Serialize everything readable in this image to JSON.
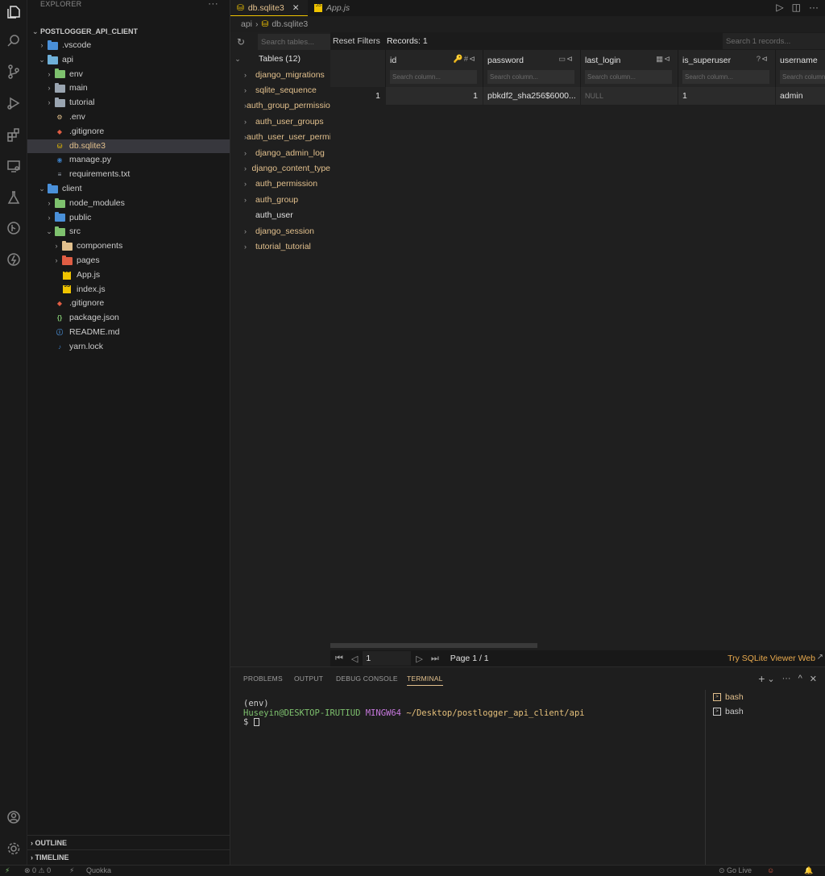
{
  "colors": {
    "accent": "#f0c400",
    "modified_file": "#e2c08d",
    "link": "#e8a94d",
    "terminal_user": "#7ec16e",
    "terminal_system": "#c678dd",
    "terminal_path": "#e5c07b"
  },
  "explorer": {
    "title": "EXPLORER",
    "project": "POSTLOGGER_API_CLIENT",
    "more": "···",
    "tree": [
      {
        "label": ".vscode",
        "type": "folder",
        "color": "#4a90d9",
        "depth": 0,
        "expanded": false
      },
      {
        "label": "api",
        "type": "folder",
        "color": "#6fb0d8",
        "depth": 0,
        "expanded": true
      },
      {
        "label": "env",
        "type": "folder",
        "color": "#7ec16e",
        "depth": 1,
        "expanded": false
      },
      {
        "label": "main",
        "type": "folder",
        "color": "#9aa5b1",
        "depth": 1,
        "expanded": false
      },
      {
        "label": "tutorial",
        "type": "folder",
        "color": "#9aa5b1",
        "depth": 1,
        "expanded": false
      },
      {
        "label": ".env",
        "type": "env",
        "color": "#e2c08d",
        "depth": 1
      },
      {
        "label": ".gitignore",
        "type": "git",
        "color": "#e05d44",
        "depth": 1
      },
      {
        "label": "db.sqlite3",
        "type": "db",
        "color": "#f0c400",
        "depth": 1,
        "selected": true,
        "modified": true
      },
      {
        "label": "manage.py",
        "type": "py",
        "color": "#3b7bbf",
        "depth": 1
      },
      {
        "label": "requirements.txt",
        "type": "txt",
        "color": "#9aa5b1",
        "depth": 1
      },
      {
        "label": "client",
        "type": "folder",
        "color": "#4a90d9",
        "depth": 0,
        "expanded": true
      },
      {
        "label": "node_modules",
        "type": "folder",
        "color": "#7ec16e",
        "depth": 1,
        "expanded": false
      },
      {
        "label": "public",
        "type": "folder",
        "color": "#4a90d9",
        "depth": 1,
        "expanded": false
      },
      {
        "label": "src",
        "type": "folder",
        "color": "#7ec16e",
        "depth": 1,
        "expanded": true
      },
      {
        "label": "components",
        "type": "folder",
        "color": "#e2c08d",
        "depth": 2,
        "expanded": false
      },
      {
        "label": "pages",
        "type": "folder",
        "color": "#e05d44",
        "depth": 2,
        "expanded": false
      },
      {
        "label": "App.js",
        "type": "js",
        "color": "#f0c400",
        "depth": 2
      },
      {
        "label": "index.js",
        "type": "js",
        "color": "#f0c400",
        "depth": 2
      },
      {
        "label": ".gitignore",
        "type": "git",
        "color": "#e05d44",
        "depth": 1
      },
      {
        "label": "package.json",
        "type": "json",
        "color": "#7ec16e",
        "depth": 1
      },
      {
        "label": "README.md",
        "type": "info",
        "color": "#4a90d9",
        "depth": 1
      },
      {
        "label": "yarn.lock",
        "type": "yarn",
        "color": "#3b7bbf",
        "depth": 1
      }
    ],
    "outline": "OUTLINE",
    "timeline": "TIMELINE"
  },
  "tabs": [
    {
      "label": "db.sqlite3",
      "active": true,
      "close": "✕"
    },
    {
      "label": "App.js",
      "active": false
    }
  ],
  "breadcrumb": {
    "folder": "api",
    "sep": "›",
    "file": "db.sqlite3"
  },
  "sqlite": {
    "table_search_placeholder": "Search tables...",
    "tables_header": "Tables (12)",
    "tables": [
      {
        "name": "django_migrations",
        "active": false
      },
      {
        "name": "sqlite_sequence",
        "active": false
      },
      {
        "name": "auth_group_permissions",
        "active": false
      },
      {
        "name": "auth_user_groups",
        "active": false
      },
      {
        "name": "auth_user_user_permissions",
        "active": false
      },
      {
        "name": "django_admin_log",
        "active": false
      },
      {
        "name": "django_content_type",
        "active": false
      },
      {
        "name": "auth_permission",
        "active": false
      },
      {
        "name": "auth_group",
        "active": false
      },
      {
        "name": "auth_user",
        "active": true
      },
      {
        "name": "django_session",
        "active": false
      },
      {
        "name": "tutorial_tutorial",
        "active": false
      }
    ],
    "reset_filters": "Reset Filters",
    "records": "Records: 1",
    "records_search_placeholder": "Search 1 records...",
    "column_search_placeholder": "Search column...",
    "columns": [
      {
        "name": "id",
        "icons": "🔑#⊲"
      },
      {
        "name": "password",
        "icons": "▭⊲"
      },
      {
        "name": "last_login",
        "icons": "▦⊲"
      },
      {
        "name": "is_superuser",
        "icons": "?⊲"
      },
      {
        "name": "username",
        "icons": ""
      }
    ],
    "rows": [
      {
        "rownum": "1",
        "cells": [
          "1",
          "pbkdf2_sha256$6000...",
          "NULL",
          "1",
          "admin"
        ]
      }
    ],
    "pager": {
      "first": "⏮",
      "prev": "◁",
      "page_value": "1",
      "next": "▷",
      "last": "⏭",
      "page_label": "Page 1 / 1"
    },
    "try_web": "Try SQLite Viewer Web",
    "try_web_icon": "↗"
  },
  "panel": {
    "tabs": [
      {
        "label": "PROBLEMS",
        "active": false
      },
      {
        "label": "OUTPUT",
        "active": false
      },
      {
        "label": "DEBUG CONSOLE",
        "active": false
      },
      {
        "label": "TERMINAL",
        "active": true
      }
    ],
    "actions": {
      "add": "+",
      "dropdown": "⌄",
      "more": "···",
      "maximize": "^",
      "close": "✕"
    },
    "terminal": {
      "line1": "(env)",
      "user": "Huseyin@DESKTOP-IRUTIUD",
      "system": "MINGW64",
      "path": "~/Desktop/postlogger_api_client/api",
      "prompt": "$ "
    },
    "terminals": [
      {
        "label": "bash",
        "active": true
      },
      {
        "label": "bash",
        "active": false
      }
    ]
  },
  "statusbar": {
    "remote": "⚡",
    "problems": "⊗ 0 ⚠ 0",
    "quokka_icon": "⚡",
    "quokka": "Quokka",
    "golive": "⊙ Go Live",
    "account_icon": "☺",
    "bell_icon": "🔔"
  }
}
